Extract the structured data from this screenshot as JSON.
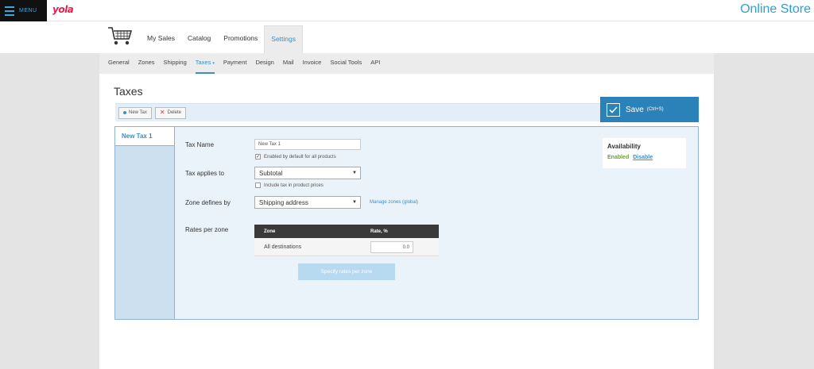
{
  "topbar": {
    "menu_label": "MENU",
    "logo": "yola",
    "site_title": "Online Store"
  },
  "mainnav": {
    "items": [
      {
        "label": "My Sales"
      },
      {
        "label": "Catalog"
      },
      {
        "label": "Promotions"
      },
      {
        "label": "Settings",
        "active": true
      }
    ]
  },
  "subnav": {
    "items": [
      {
        "label": "General"
      },
      {
        "label": "Zones"
      },
      {
        "label": "Shipping"
      },
      {
        "label": "Taxes",
        "active": true
      },
      {
        "label": "Payment"
      },
      {
        "label": "Design"
      },
      {
        "label": "Mail"
      },
      {
        "label": "Invoice"
      },
      {
        "label": "Social Tools"
      },
      {
        "label": "API"
      }
    ]
  },
  "page": {
    "title": "Taxes"
  },
  "toolbar": {
    "new_tax_label": "New Tax",
    "delete_label": "Delete"
  },
  "save": {
    "label": "Save",
    "hint": "(Ctrl+S)"
  },
  "sidebar": {
    "tab_label": "New Tax 1"
  },
  "form": {
    "tax_name_label": "Tax Name",
    "tax_name_value": "New Tax 1",
    "enabled_default_label": "Enabled by default for all products",
    "applies_to_label": "Tax applies to",
    "applies_to_value": "Subtotal",
    "include_tax_label": "Include tax in product prices",
    "zone_defines_label": "Zone defines by",
    "zone_defines_value": "Shipping address",
    "manage_zones_link": "Manage zones (global)",
    "rates_label": "Rates per zone",
    "rates_table": {
      "col_zone": "Zone",
      "col_rate": "Rate, %",
      "rows": [
        {
          "zone": "All destinations",
          "rate": "0.0"
        }
      ]
    },
    "specify_rates_button": "Specify rates per zone"
  },
  "availability": {
    "title": "Availability",
    "status": "Enabled",
    "action": "Disable"
  },
  "colors": {
    "accent": "#2b82b8",
    "link": "#3b8fc4",
    "logo": "#e8204f",
    "enabled": "#6aa030"
  }
}
